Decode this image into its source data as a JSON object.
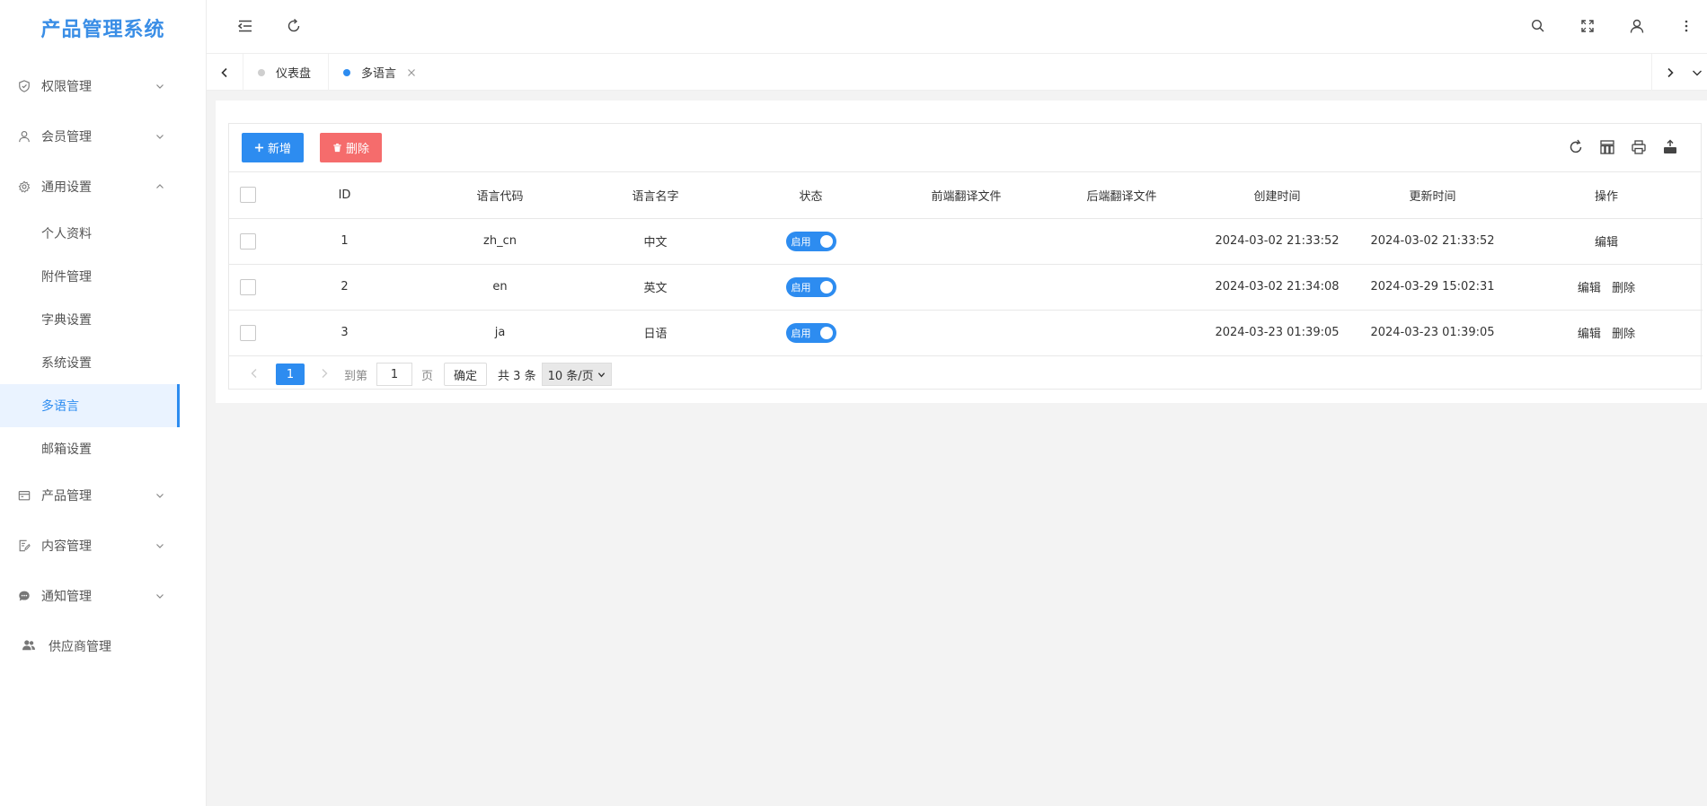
{
  "app": {
    "title": "产品管理系统"
  },
  "sidebar": {
    "items": [
      {
        "label": "权限管理",
        "icon": "shield-icon"
      },
      {
        "label": "会员管理",
        "icon": "user-icon"
      },
      {
        "label": "通用设置",
        "icon": "gear-icon",
        "expanded": true
      },
      {
        "label": "产品管理",
        "icon": "product-icon"
      },
      {
        "label": "内容管理",
        "icon": "edit-doc-icon"
      },
      {
        "label": "通知管理",
        "icon": "chat-icon"
      },
      {
        "label": "供应商管理",
        "icon": "users-icon"
      }
    ],
    "sub_items": [
      "个人资料",
      "附件管理",
      "字典设置",
      "系统设置",
      "多语言",
      "邮箱设置"
    ],
    "active_sub": "多语言"
  },
  "header": {
    "icons": [
      "menu-fold-icon",
      "refresh-icon",
      "search-icon",
      "fullscreen-icon",
      "user-icon",
      "more-icon"
    ]
  },
  "tabs": [
    {
      "label": "仪表盘",
      "active": false
    },
    {
      "label": "多语言",
      "active": true
    }
  ],
  "toolbar": {
    "add_label": "新增",
    "delete_label": "删除",
    "icons": [
      "refresh-icon",
      "columns-icon",
      "print-icon",
      "export-icon"
    ]
  },
  "table": {
    "columns": [
      "ID",
      "语言代码",
      "语言名字",
      "状态",
      "前端翻译文件",
      "后端翻译文件",
      "创建时间",
      "更新时间",
      "操作"
    ],
    "rows": [
      {
        "id": "1",
        "code": "zh_cn",
        "name": "中文",
        "status": "启用",
        "front_file": "",
        "back_file": "",
        "created": "2024-03-02 21:33:52",
        "updated": "2024-03-02 21:33:52",
        "actions": [
          "编辑"
        ]
      },
      {
        "id": "2",
        "code": "en",
        "name": "英文",
        "status": "启用",
        "front_file": "",
        "back_file": "",
        "created": "2024-03-02 21:34:08",
        "updated": "2024-03-29 15:02:31",
        "actions": [
          "编辑",
          "删除"
        ]
      },
      {
        "id": "3",
        "code": "ja",
        "name": "日语",
        "status": "启用",
        "front_file": "",
        "back_file": "",
        "created": "2024-03-23 01:39:05",
        "updated": "2024-03-23 01:39:05",
        "actions": [
          "编辑",
          "删除"
        ]
      }
    ]
  },
  "pagination": {
    "current_page": "1",
    "goto_label": "到第",
    "goto_value": "1",
    "page_label": "页",
    "confirm_label": "确定",
    "total": "共 3 条",
    "page_size": "10 条/页"
  },
  "colors": {
    "primary": "#2d8cf0",
    "danger": "#f56c6c",
    "logo": "#3a8ee6"
  }
}
